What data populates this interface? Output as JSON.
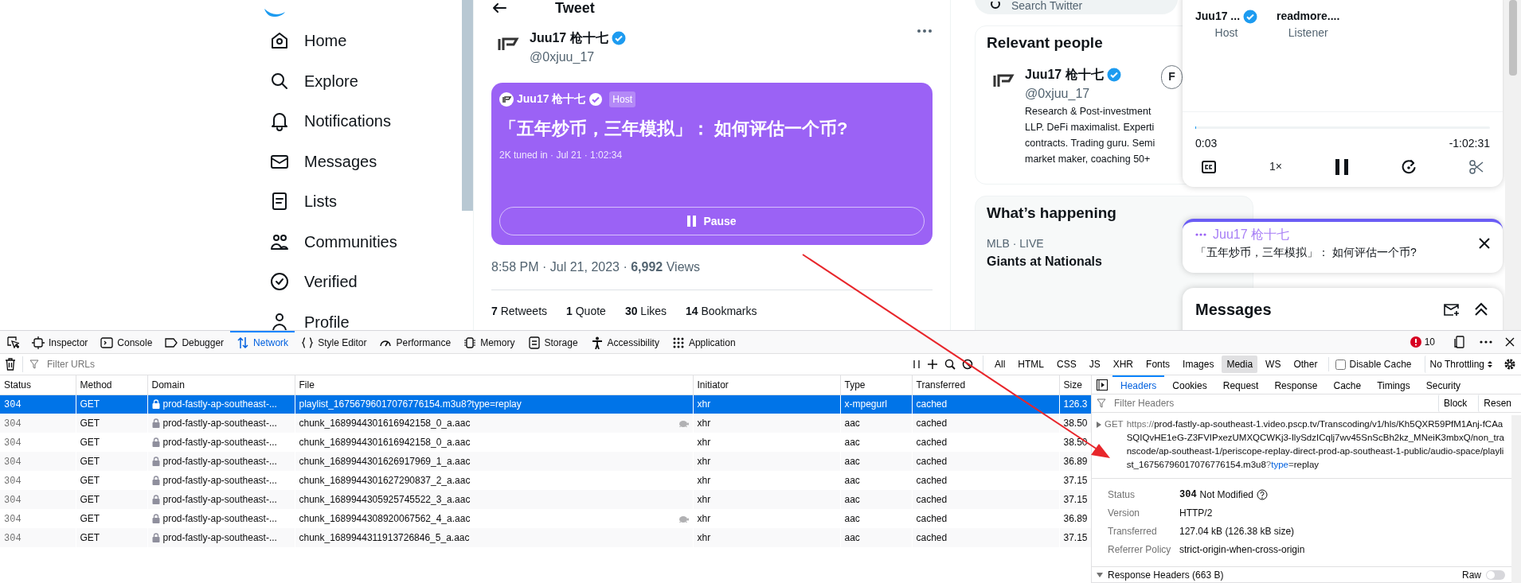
{
  "twitter": {
    "nav": [
      {
        "label": "Home"
      },
      {
        "label": "Explore"
      },
      {
        "label": "Notifications"
      },
      {
        "label": "Messages"
      },
      {
        "label": "Lists"
      },
      {
        "label": "Communities"
      },
      {
        "label": "Verified"
      },
      {
        "label": "Profile"
      }
    ],
    "page_title": "Tweet",
    "tweet": {
      "author": "Juu17 枪十七",
      "handle": "@0xjuu_17",
      "space": {
        "host_name": "Juu17 枪十七",
        "host_badge": "Host",
        "title": "「五年炒币，三年模拟」： 如何评估一个币?",
        "meta": "2K tuned in · Jul 21 · 1:02:34",
        "button": "Pause"
      },
      "timestamp": "8:58 PM · Jul 21, 2023 · **6,992** Views",
      "stats": [
        "**7** Retweets",
        "**1** Quote",
        "**30** Likes",
        "**14** Bookmarks"
      ]
    },
    "search": {
      "placeholder": "Search Twitter"
    },
    "relevant_people": {
      "title": "Relevant people",
      "person": {
        "name": "Juu17 枪十七",
        "handle": "@0xjuu_17",
        "follow": "F",
        "bio": [
          "Research & Post-investment",
          "LLP. DeFi maximalist. Experti",
          "contracts. Trading guru. Semi",
          "market maker, coaching 50+"
        ]
      }
    },
    "whats_happening": {
      "title": "What’s happening",
      "trend": {
        "context": "MLB · LIVE",
        "title": "Giants at Nationals"
      }
    },
    "player": {
      "speakers": [
        {
          "name": "Juu17 ...",
          "role": "Host",
          "verified": true
        },
        {
          "name": "readmore....",
          "role": "Listener",
          "verified": false
        }
      ],
      "level": 0.001,
      "elapsed": "0:03",
      "remaining": "-1:02:31",
      "speed": "1×"
    },
    "space_dock": {
      "host": "Juu17 枪十七",
      "title": "「五年炒币，三年模拟」： 如何评估一个币?"
    },
    "messages": {
      "title": "Messages"
    }
  },
  "devtools": {
    "tools": [
      {
        "label": "Inspector",
        "selected": false
      },
      {
        "label": "Console",
        "selected": false
      },
      {
        "label": "Debugger",
        "selected": false
      },
      {
        "label": "Network",
        "selected": true
      },
      {
        "label": "Style Editor",
        "selected": false
      },
      {
        "label": "Performance",
        "selected": false
      },
      {
        "label": "Memory",
        "selected": false
      },
      {
        "label": "Storage",
        "selected": false
      },
      {
        "label": "Accessibility",
        "selected": false
      },
      {
        "label": "Application",
        "selected": false
      }
    ],
    "error_count": "10",
    "filter_placeholder": "Filter URLs",
    "type_filters": [
      {
        "label": "All",
        "selected": false
      },
      {
        "label": "HTML",
        "selected": false
      },
      {
        "label": "CSS",
        "selected": false
      },
      {
        "label": "JS",
        "selected": false
      },
      {
        "label": "XHR",
        "selected": false
      },
      {
        "label": "Fonts",
        "selected": false
      },
      {
        "label": "Images",
        "selected": false
      },
      {
        "label": "Media",
        "selected": true
      },
      {
        "label": "WS",
        "selected": false
      },
      {
        "label": "Other",
        "selected": false
      }
    ],
    "disable_cache": {
      "label": "Disable Cache",
      "checked": false
    },
    "throttling": "No Throttling",
    "columns": [
      "Status",
      "Method",
      "Domain",
      "File",
      "Initiator",
      "Type",
      "Transferred",
      "Size"
    ],
    "requests": [
      {
        "status": "304",
        "method": "GET",
        "domain": "prod-fastly-ap-southeast-...",
        "file": "playlist_16756796017076776154.m3u8?type=replay",
        "slow": false,
        "initiator": "xhr",
        "type": "x-mpegurl",
        "transferred": "cached",
        "size": "126.3",
        "selected": true
      },
      {
        "status": "304",
        "method": "GET",
        "domain": "prod-fastly-ap-southeast-...",
        "file": "chunk_1689944301616942158_0_a.aac",
        "slow": true,
        "initiator": "xhr",
        "type": "aac",
        "transferred": "cached",
        "size": "38.50",
        "selected": false
      },
      {
        "status": "304",
        "method": "GET",
        "domain": "prod-fastly-ap-southeast-...",
        "file": "chunk_1689944301616942158_0_a.aac",
        "slow": false,
        "initiator": "xhr",
        "type": "aac",
        "transferred": "cached",
        "size": "38.50",
        "selected": false
      },
      {
        "status": "304",
        "method": "GET",
        "domain": "prod-fastly-ap-southeast-...",
        "file": "chunk_1689944301626917969_1_a.aac",
        "slow": false,
        "initiator": "xhr",
        "type": "aac",
        "transferred": "cached",
        "size": "36.89",
        "selected": false
      },
      {
        "status": "304",
        "method": "GET",
        "domain": "prod-fastly-ap-southeast-...",
        "file": "chunk_1689944301627290837_2_a.aac",
        "slow": false,
        "initiator": "xhr",
        "type": "aac",
        "transferred": "cached",
        "size": "37.15",
        "selected": false
      },
      {
        "status": "304",
        "method": "GET",
        "domain": "prod-fastly-ap-southeast-...",
        "file": "chunk_1689944305925745522_3_a.aac",
        "slow": false,
        "initiator": "xhr",
        "type": "aac",
        "transferred": "cached",
        "size": "37.15",
        "selected": false
      },
      {
        "status": "304",
        "method": "GET",
        "domain": "prod-fastly-ap-southeast-...",
        "file": "chunk_1689944308920067562_4_a.aac",
        "slow": true,
        "initiator": "xhr",
        "type": "aac",
        "transferred": "cached",
        "size": "36.89",
        "selected": false
      },
      {
        "status": "304",
        "method": "GET",
        "domain": "prod-fastly-ap-southeast-...",
        "file": "chunk_1689944311913726846_5_a.aac",
        "slow": false,
        "initiator": "xhr",
        "type": "aac",
        "transferred": "cached",
        "size": "37.15",
        "selected": false
      }
    ],
    "details": {
      "tabs": [
        {
          "label": "Headers",
          "selected": true
        },
        {
          "label": "Cookies",
          "selected": false
        },
        {
          "label": "Request",
          "selected": false
        },
        {
          "label": "Response",
          "selected": false
        },
        {
          "label": "Cache",
          "selected": false
        },
        {
          "label": "Timings",
          "selected": false
        },
        {
          "label": "Security",
          "selected": false
        }
      ],
      "filter_placeholder": "Filter Headers",
      "actions": [
        "Block",
        "Resen"
      ],
      "method": "GET",
      "url_parts": [
        {
          "kind": "scheme",
          "text": "https://"
        },
        {
          "kind": "path",
          "text": "prod-fastly-ap-southeast-1.video.pscp.tv/Transcoding/v1/hls/Kh5QXR59PfM1Anj-fCAaSQIQvHE1eG-Z3FVIPxezUMXQCWKj3-IlySdzICqlj7wv45SnScBh2kz_MNeiK3mbxQ/non_transcode/ap-southeast-1/periscope-replay-direct-prod-ap-southeast-1-public/audio-space/playlist_16756796017076776154.m3u8"
        },
        {
          "kind": "punct",
          "text": "?"
        },
        {
          "kind": "key",
          "text": "type"
        },
        {
          "kind": "punct",
          "text": "="
        },
        {
          "kind": "value",
          "text": "replay"
        }
      ],
      "fields": [
        {
          "kind": "status",
          "label": "Status",
          "code": "304",
          "value": "Not Modified"
        },
        {
          "kind": "text",
          "label": "Version",
          "value": "HTTP/2"
        },
        {
          "kind": "text",
          "label": "Transferred",
          "value": "127.04 kB (126.38 kB size)"
        },
        {
          "kind": "text",
          "label": "Referrer Policy",
          "value": "strict-origin-when-cross-origin"
        }
      ],
      "response_headers": {
        "title": "Response Headers (663 B)",
        "raw_label": "Raw",
        "raw_on": false
      }
    }
  }
}
